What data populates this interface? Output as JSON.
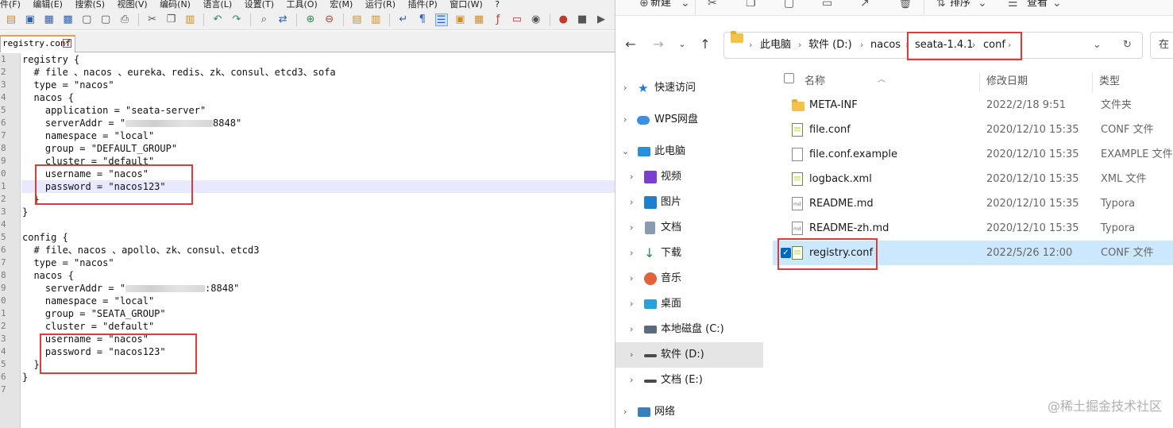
{
  "editor": {
    "menu": [
      "件(F)",
      "编辑(E)",
      "搜索(S)",
      "视图(V)",
      "编码(N)",
      "语言(L)",
      "设置(T)",
      "工具(O)",
      "宏(M)",
      "运行(R)",
      "插件(P)",
      "窗口(W)",
      "?"
    ],
    "tab_label": "registry.conf",
    "line_numbers": [
      "1",
      "2",
      "3",
      "4",
      "5",
      "6",
      "7",
      "8",
      "9",
      "0",
      "1",
      "2",
      "3",
      "4",
      "5",
      "6",
      "7",
      "8",
      "9",
      "0",
      "1",
      "2",
      "3",
      "4",
      "5",
      "6",
      "7"
    ],
    "lines": [
      "registry {",
      "  # file 、nacos 、eureka、redis、zk、consul、etcd3、sofa",
      "  type = \"nacos\"",
      "  nacos {",
      "    application = \"seata-server\"",
      "    serverAddr = \"",
      "8848\"",
      "    namespace = \"local\"",
      "    group = \"DEFAULT_GROUP\"",
      "    cluster = \"default\"",
      "    username = \"nacos\"",
      "    password = \"nacos123\"",
      "  }",
      "}",
      "",
      "config {",
      "  # file、nacos 、apollo、zk、consul、etcd3",
      "  type = \"nacos\"",
      "  nacos {",
      "    serverAddr = \"",
      ":8848\"",
      "    namespace = \"local\"",
      "    group = \"SEATA_GROUP\"",
      "    cluster = \"default\"",
      "    username = \"nacos\"",
      "    password = \"nacos123\"",
      "  }",
      "}"
    ]
  },
  "explorer": {
    "cmdbar": {
      "new": "新建",
      "sort": "排序",
      "view": "查看"
    },
    "address": {
      "root": "此电脑",
      "drive": "软件 (D:)",
      "folder1": "nacos",
      "folder2": "seata-1.4.1",
      "folder3": "conf"
    },
    "search_hint": "在",
    "nav": [
      {
        "label": "快速访问"
      },
      {
        "label": "WPS网盘"
      },
      {
        "label": "此电脑"
      },
      {
        "label": "视频"
      },
      {
        "label": "图片"
      },
      {
        "label": "文档"
      },
      {
        "label": "下载"
      },
      {
        "label": "音乐"
      },
      {
        "label": "桌面"
      },
      {
        "label": "本地磁盘 (C:)"
      },
      {
        "label": "软件 (D:)"
      },
      {
        "label": "文档 (E:)"
      },
      {
        "label": "网络"
      }
    ],
    "columns": {
      "name": "名称",
      "date": "修改日期",
      "type": "类型"
    },
    "files": [
      {
        "name": "META-INF",
        "date": "2022/2/18 9:51",
        "type": "文件夹"
      },
      {
        "name": "file.conf",
        "date": "2020/12/10 15:35",
        "type": "CONF 文件"
      },
      {
        "name": "file.conf.example",
        "date": "2020/12/10 15:35",
        "type": "EXAMPLE 文件"
      },
      {
        "name": "logback.xml",
        "date": "2020/12/10 15:35",
        "type": "XML 文件"
      },
      {
        "name": "README.md",
        "date": "2020/12/10 15:35",
        "type": "Typora"
      },
      {
        "name": "README-zh.md",
        "date": "2020/12/10 15:35",
        "type": "Typora"
      },
      {
        "name": "registry.conf",
        "date": "2022/5/26 12:00",
        "type": "CONF 文件"
      }
    ]
  },
  "watermark": "@稀土掘金技术社区"
}
